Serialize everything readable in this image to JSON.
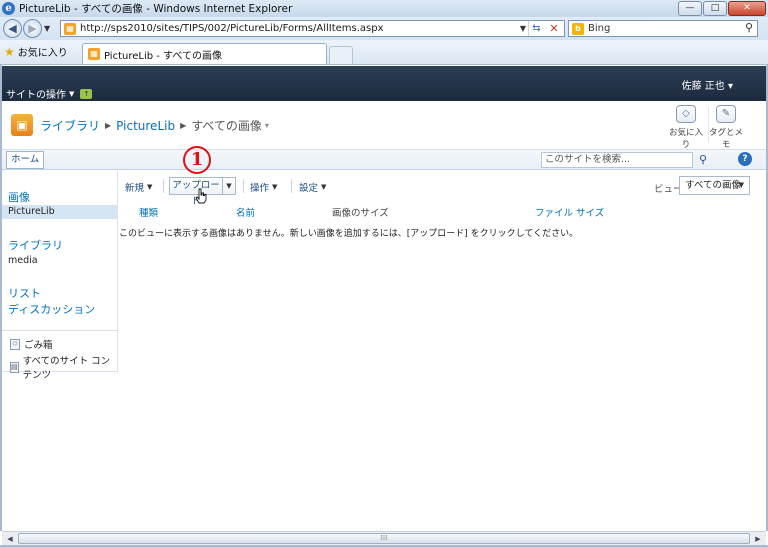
{
  "window": {
    "title": "PictureLib - すべての画像 - Windows Internet Explorer",
    "minimize": "—",
    "restore": "□",
    "close": "✕"
  },
  "browser": {
    "url": "http://sps2010/sites/TIPS/002/PictureLib/Forms/AllItems.aspx",
    "search_provider": "Bing",
    "favorites_label": "お気に入り",
    "tab_title": "PictureLib - すべての画像"
  },
  "sharepoint": {
    "site_actions": "サイトの操作",
    "user_name": "佐藤 正也",
    "breadcrumb": {
      "root": "ライブラリ",
      "library": "PictureLib",
      "view": "すべての画像"
    },
    "social": {
      "like": "お気に入り",
      "tags": "タグとメモ"
    },
    "topnav": {
      "home": "ホーム",
      "search_placeholder": "このサイトを検索..."
    },
    "quicklaunch": {
      "heading_pictures": "画像",
      "item_picturelib": "PictureLib",
      "heading_libraries": "ライブラリ",
      "item_media": "media",
      "heading_lists": "リスト",
      "heading_discussions": "ディスカッション",
      "recycle_bin": "ごみ箱",
      "all_content": "すべてのサイト コンテンツ"
    },
    "toolbar": {
      "new": "新規",
      "upload": "アップロード",
      "actions": "操作",
      "settings": "設定",
      "view_label": "ビュー:",
      "view_value": "すべての画像"
    },
    "columns": {
      "type": "種類",
      "name": "名前",
      "picture_size": "画像のサイズ",
      "file_size": "ファイル サイズ"
    },
    "empty_message": "このビューに表示する画像はありません。新しい画像を追加するには、[アップロード] をクリックしてください。",
    "step_marker": "1"
  },
  "icons": {
    "back": "back-arrow-icon",
    "forward": "forward-arrow-icon",
    "refresh": "refresh-icon",
    "stop": "stop-icon",
    "search": "magnifier-icon",
    "favorites": "star-icon",
    "library": "picture-library-icon",
    "help": "help-icon"
  },
  "colors": {
    "link_blue": "#0072bc",
    "ribbon_dark": "#1d2b3e",
    "marker_red": "#dd1111"
  }
}
